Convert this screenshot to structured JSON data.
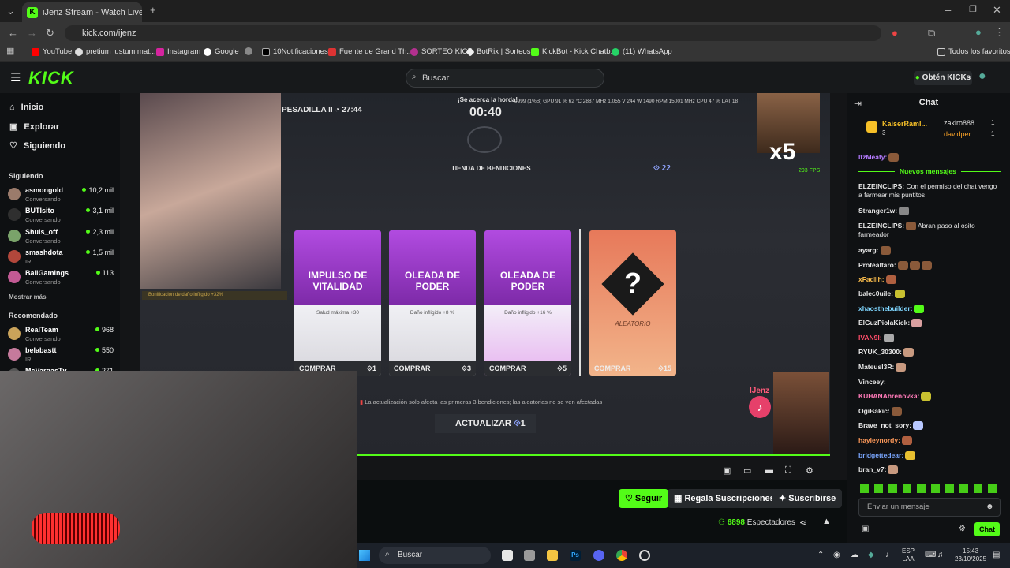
{
  "browser": {
    "tab_title": "iJenz Stream - Watch Live o",
    "url": "kick.com/ijenz",
    "bookmarks": [
      "YouTube",
      "pretium iustum mat...",
      "Instagram",
      "Google",
      "10Notificaciones",
      "Fuente de Grand Th...",
      "SORTEO KICK",
      "BotRix | Sorteos",
      "KickBot - Kick Chatb...",
      "(11) WhatsApp"
    ],
    "all_favorites": "Todos los favoritos"
  },
  "header": {
    "logo": "KICK",
    "search_placeholder": "Buscar",
    "kicks_button": "Obtén KICKs"
  },
  "sidebar": {
    "nav": [
      "Inicio",
      "Explorar",
      "Siguiendo"
    ],
    "following_title": "Siguiendo",
    "following": [
      {
        "name": "asmongold",
        "status": "Conversando",
        "viewers": "10,2 mil",
        "color": "#9b7b6b"
      },
      {
        "name": "BUTIsito",
        "status": "Conversando",
        "viewers": "3,1 mil",
        "color": "#2f2f2f"
      },
      {
        "name": "Shuls_off",
        "status": "Conversando",
        "viewers": "2,3 mil",
        "color": "#7aa36a"
      },
      {
        "name": "smashdota",
        "status": "IRL",
        "viewers": "1,5 mil",
        "color": "#b2473b"
      },
      {
        "name": "BaliGamings",
        "status": "Conversando",
        "viewers": "113",
        "color": "#c25a94"
      }
    ],
    "show_more": "Mostrar más",
    "recommended_title": "Recomendado",
    "recommended": [
      {
        "name": "RealTeam",
        "status": "Conversando",
        "viewers": "968",
        "color": "#caa35a"
      },
      {
        "name": "belabastt",
        "status": "IRL",
        "viewers": "550",
        "color": "#c57a9c"
      },
      {
        "name": "McVargasTv",
        "status": "",
        "viewers": "271",
        "color": "#555"
      }
    ]
  },
  "game": {
    "nightmare": "PESADILLA II",
    "timer_label": "27:44",
    "horde_label": "¡Se acerca la horda!",
    "horde_timer": "00:40",
    "perf": "9999 (1%B)   GPU 91 % 62 °C 2887 MHz 1.055 V 244 W 1490 RPM 15001 MHz   CPU 47 %   LAT 18",
    "shop_title": "TIENDA DE BENDICIONES",
    "currency": "22",
    "multiplier": "x5",
    "fps": "293 FPS",
    "bonus_note": "Bonificación de daño infligido +32%",
    "cards": [
      {
        "title": "IMPULSO DE VITALIDAD",
        "desc": "Salud máxima +30",
        "buy": "COMPRAR",
        "cost": "1"
      },
      {
        "title": "OLEADA DE PODER",
        "desc": "Daño infligido +8 %",
        "buy": "COMPRAR",
        "cost": "3"
      },
      {
        "title": "OLEADA DE PODER",
        "desc": "Daño infligido +16 %",
        "buy": "COMPRAR",
        "cost": "5"
      },
      {
        "title": "ALEATORIO",
        "desc": "",
        "buy": "COMPRAR",
        "cost": "15"
      }
    ],
    "update_note": "La actualización solo afecta las primeras 3 bendiciones; las aleatorias no se ven afectadas",
    "update_button": "ACTUALIZAR",
    "update_cost": "1",
    "streamer_tag": "IJenz"
  },
  "below_player": {
    "follow": "Seguir",
    "gift": "Regala Suscripciones",
    "subscribe": "Suscribirse",
    "viewers": "6898",
    "viewers_label": "Espectadores"
  },
  "chat": {
    "title": "Chat",
    "pinned": [
      {
        "name": "KaiserRaml...",
        "count": "3"
      },
      {
        "name": "zakiro888",
        "count": "1"
      },
      {
        "name": "davidper...",
        "count": "1"
      }
    ],
    "new_messages": "Nuevos mensajes",
    "messages": [
      {
        "user": "ItzMeaty:",
        "color": "#b57bff",
        "text": ""
      },
      {
        "user": "ELZEINCLIPS:",
        "color": "#ffffff",
        "text": "Con el permiso del chat vengo a farmear mis puntitos"
      },
      {
        "user": "Stranger1w:",
        "color": "#ffffff",
        "text": ""
      },
      {
        "user": "ELZEINCLIPS:",
        "color": "#ffffff",
        "text": "Abran paso al osito farmeador"
      },
      {
        "user": "ayarg:",
        "color": "#ffffff",
        "text": ""
      },
      {
        "user": "Profealfaro:",
        "color": "#ffffff",
        "text": ""
      },
      {
        "user": "xFadlih:",
        "color": "#ffc04d",
        "text": ""
      },
      {
        "user": "balec0uile:",
        "color": "#ffffff",
        "text": ""
      },
      {
        "user": "xhaosthebuilder:",
        "color": "#7fd6ff",
        "text": ""
      },
      {
        "user": "ElGuzPiolaKick:",
        "color": "#ffffff",
        "text": ""
      },
      {
        "user": "IVAN9I:",
        "color": "#ff4d6a",
        "text": ""
      },
      {
        "user": "RYUK_30300:",
        "color": "#ffffff",
        "text": ""
      },
      {
        "user": "Mateusl3R:",
        "color": "#ffffff",
        "text": ""
      },
      {
        "user": "Vinceey:",
        "color": "#ffffff",
        "text": ""
      },
      {
        "user": "KUHANAhrenovka:",
        "color": "#ff7ab8",
        "text": ""
      },
      {
        "user": "OgiBakic:",
        "color": "#ffffff",
        "text": ""
      },
      {
        "user": "Brave_not_sory:",
        "color": "#ffffff",
        "text": ""
      },
      {
        "user": "hayleynordy:",
        "color": "#ff9a5a",
        "text": ""
      },
      {
        "user": "bridgettedear:",
        "color": "#7aa7ff",
        "text": ""
      },
      {
        "user": "bran_v7:",
        "color": "#ffffff",
        "text": ""
      }
    ],
    "input_placeholder": "Enviar un mensaje",
    "send": "Chat"
  },
  "taskbar": {
    "search": "Buscar",
    "lang_top": "ESP",
    "lang_bottom": "LAA",
    "time": "15:43",
    "date": "23/10/2025"
  }
}
